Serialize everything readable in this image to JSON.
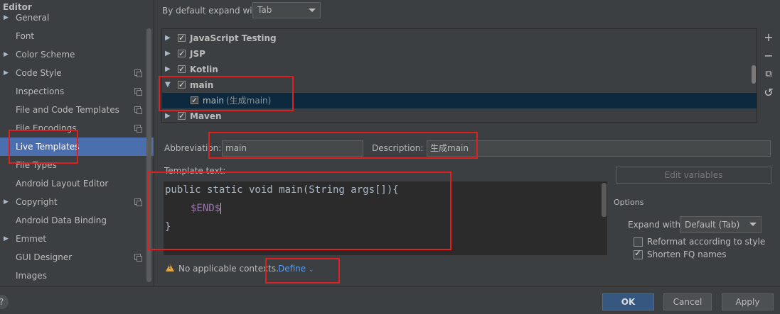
{
  "sidebar": {
    "title": "Editor",
    "items": [
      {
        "label": "General",
        "expandable": true,
        "copy_icon": false,
        "selected": false
      },
      {
        "label": "Font",
        "expandable": false,
        "copy_icon": false,
        "selected": false
      },
      {
        "label": "Color Scheme",
        "expandable": true,
        "copy_icon": false,
        "selected": false
      },
      {
        "label": "Code Style",
        "expandable": true,
        "copy_icon": true,
        "selected": false
      },
      {
        "label": "Inspections",
        "expandable": false,
        "copy_icon": true,
        "selected": false
      },
      {
        "label": "File and Code Templates",
        "expandable": false,
        "copy_icon": true,
        "selected": false
      },
      {
        "label": "File Encodings",
        "expandable": false,
        "copy_icon": true,
        "selected": false
      },
      {
        "label": "Live Templates",
        "expandable": false,
        "copy_icon": false,
        "selected": true
      },
      {
        "label": "File Types",
        "expandable": false,
        "copy_icon": false,
        "selected": false
      },
      {
        "label": "Android Layout Editor",
        "expandable": false,
        "copy_icon": false,
        "selected": false
      },
      {
        "label": "Copyright",
        "expandable": true,
        "copy_icon": true,
        "selected": false
      },
      {
        "label": "Android Data Binding",
        "expandable": false,
        "copy_icon": false,
        "selected": false
      },
      {
        "label": "Emmet",
        "expandable": true,
        "copy_icon": false,
        "selected": false
      },
      {
        "label": "GUI Designer",
        "expandable": false,
        "copy_icon": true,
        "selected": false
      },
      {
        "label": "Images",
        "expandable": false,
        "copy_icon": false,
        "selected": false
      }
    ]
  },
  "expand": {
    "label": "By default expand with",
    "value": "Tab"
  },
  "tree": {
    "rows": [
      {
        "label": "JavaScript Testing",
        "expanded": false,
        "checked": true,
        "child": false
      },
      {
        "label": "JSP",
        "expanded": false,
        "checked": true,
        "child": false
      },
      {
        "label": "Kotlin",
        "expanded": false,
        "checked": true,
        "child": false
      },
      {
        "label": "main",
        "expanded": true,
        "checked": true,
        "child": false
      },
      {
        "label": "main",
        "description": "(生成main)",
        "checked": true,
        "child": true,
        "selected": true
      },
      {
        "label": "Maven",
        "expanded": false,
        "checked": true,
        "child": false
      }
    ],
    "toolbar": {
      "add": "+",
      "remove": "−",
      "copy": "⧉",
      "restore": "↺"
    }
  },
  "fields": {
    "abbreviation_label": "Abbreviation:",
    "abbreviation_value": "main",
    "description_label": "Description:",
    "description_value": "生成main"
  },
  "template": {
    "label": "Template text:",
    "lines": [
      "public static void main(String args[]){",
      "$END$",
      "}"
    ]
  },
  "right_panel": {
    "edit_variables": "Edit variables",
    "options_label": "Options",
    "expand_with_label": "Expand with",
    "expand_with_value": "Default (Tab)",
    "reformat_label": "Reformat according to style",
    "reformat_checked": false,
    "shorten_label": "Shorten FQ names",
    "shorten_checked": true
  },
  "context": {
    "warning": "No applicable contexts.",
    "define": "Define"
  },
  "buttons": {
    "help": "?",
    "ok": "OK",
    "cancel": "Cancel",
    "apply": "Apply"
  },
  "colors": {
    "background": "#3c3f41",
    "selection": "#4b6eaf",
    "editor_bg": "#2b2b2b",
    "annotation_red": "#e02020",
    "link": "#589df6"
  }
}
